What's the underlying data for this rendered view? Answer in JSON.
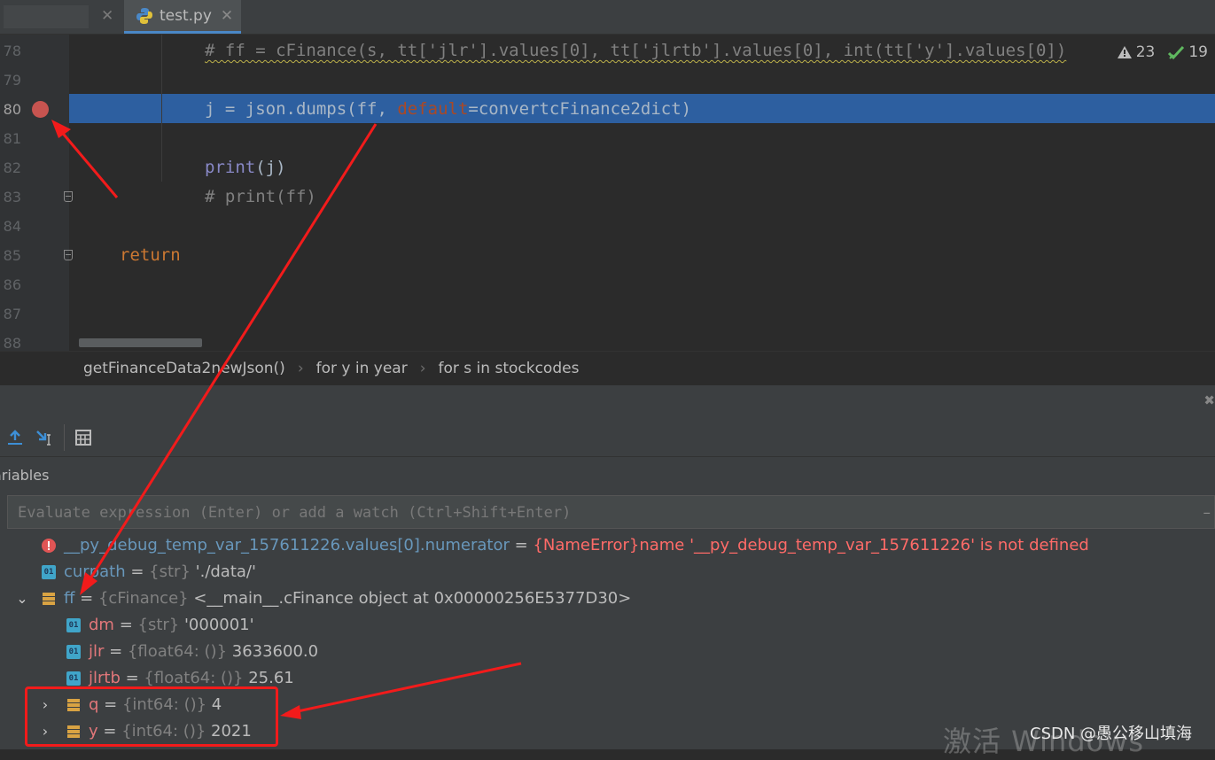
{
  "tabs": [
    {
      "label": "",
      "active": false
    },
    {
      "label": "test.py",
      "active": true
    }
  ],
  "editor": {
    "lines": [
      {
        "num": "78"
      },
      {
        "num": "79"
      },
      {
        "num": "80"
      },
      {
        "num": "81"
      },
      {
        "num": "82"
      },
      {
        "num": "83"
      },
      {
        "num": "84"
      },
      {
        "num": "85"
      },
      {
        "num": "86"
      },
      {
        "num": "87"
      },
      {
        "num": "88"
      }
    ],
    "code": {
      "l78": "# ff = cFinance(s, tt['jlr'].values[0], tt['jlrtb'].values[0], int(tt['y'].values[0])",
      "l80_a": "j = json.dumps(ff, ",
      "l80_b": "default",
      "l80_c": "=convertcFinance2dict)",
      "l82_a": "print",
      "l82_b": "(j)",
      "l83": "# print(ff)",
      "l85": "return"
    },
    "inspection": {
      "warnings": "23",
      "ok": "19"
    }
  },
  "breadcrumb": [
    "getFinanceData2newJson()",
    "for y in year",
    "for s in stockcodes"
  ],
  "debug": {
    "variables_label": "ariables",
    "eval_placeholder": "Evaluate expression (Enter) or add a watch (Ctrl+Shift+Enter)",
    "vars": [
      {
        "name": "__py_debug_temp_var_157611226.values[0].numerator",
        "eq": " = ",
        "type": "",
        "value": "{NameError}name '__py_debug_temp_var_157611226' is not defined"
      },
      {
        "name": "curpath",
        "eq": " = ",
        "type": "{str}",
        "value": " './data/'"
      },
      {
        "name": "ff",
        "eq": " = ",
        "type": "{cFinance}",
        "value": " <__main__.cFinance object at 0x00000256E5377D30>"
      },
      {
        "name": "dm",
        "eq": " = ",
        "type": "{str}",
        "value": " '000001'"
      },
      {
        "name": "jlr",
        "eq": " = ",
        "type": "{float64: ()}",
        "value": " 3633600.0"
      },
      {
        "name": "jlrtb",
        "eq": " = ",
        "type": "{float64: ()}",
        "value": " 25.61"
      },
      {
        "name": "q",
        "eq": " = ",
        "type": "{int64: ()}",
        "value": " 4"
      },
      {
        "name": "y",
        "eq": " = ",
        "type": "{int64: ()}",
        "value": " 2021"
      }
    ]
  },
  "watermark": "激活 Windows",
  "csdn": "CSDN @愚公移山填海",
  "colors": {
    "accent": "#2d5fa0",
    "breakpoint": "#c75450",
    "annotation": "#f21b1b"
  }
}
